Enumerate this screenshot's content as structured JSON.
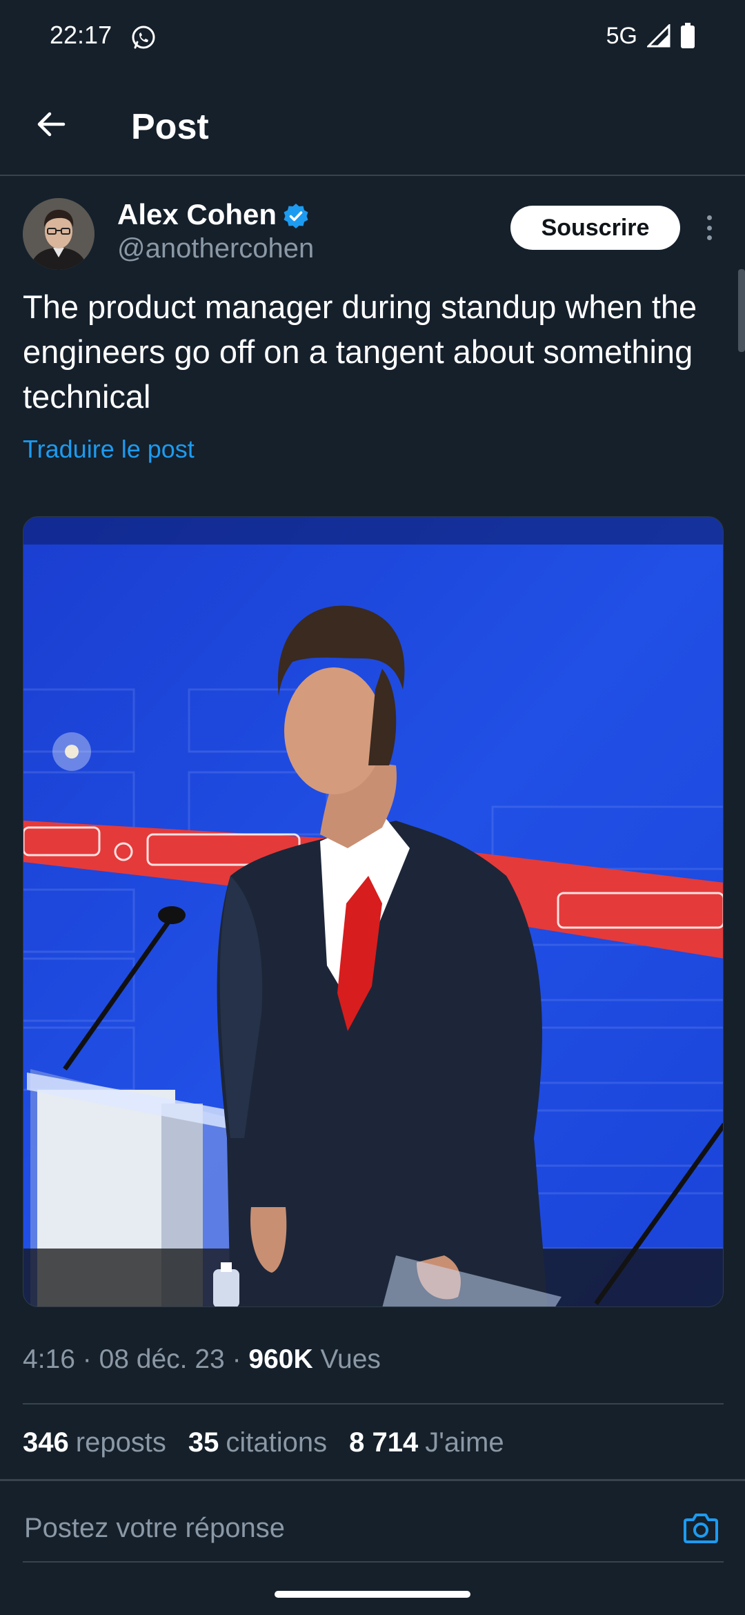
{
  "status_bar": {
    "time": "22:17",
    "network": "5G",
    "icons": [
      "whatsapp-icon",
      "signal-icon",
      "battery-icon"
    ]
  },
  "header": {
    "title": "Post",
    "back_icon": "arrow-left-icon"
  },
  "author": {
    "name": "Alex Cohen",
    "handle": "@anothercohen",
    "verified": true,
    "verified_color": "#1d9bf0"
  },
  "subscribe_label": "Souscrire",
  "post": {
    "text": "The product manager during standup when the engineers go off on a tangent about something technical",
    "translate_label": "Traduire le post",
    "media": {
      "type": "image"
    }
  },
  "meta": {
    "time": "4:16",
    "date": "08 déc. 23",
    "views_count": "960K",
    "views_label": "Vues"
  },
  "stats": {
    "reposts_count": "346",
    "reposts_label": "reposts",
    "quotes_count": "35",
    "quotes_label": "citations",
    "likes_count": "8 714",
    "likes_label": "J'aime"
  },
  "reply": {
    "placeholder": "Postez votre réponse",
    "camera_icon": "camera-icon"
  },
  "colors": {
    "background": "#15202b",
    "accent": "#1d9bf0",
    "muted": "#8b98a5",
    "divider": "#38444d"
  }
}
